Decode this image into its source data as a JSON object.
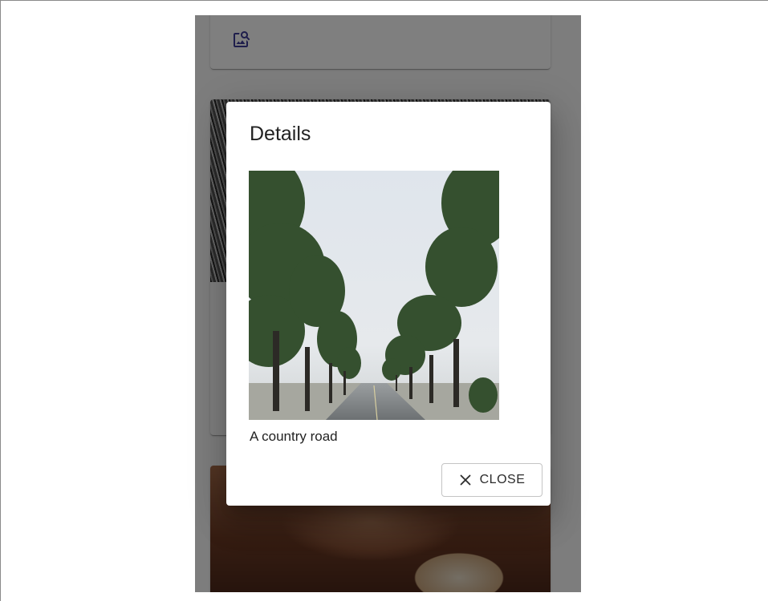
{
  "dialog": {
    "title": "Details",
    "image_alt": "A country road",
    "caption": "A country road",
    "close_label": "CLOSE"
  },
  "background": {
    "icons": {
      "image_search": "image-search-icon"
    }
  },
  "colors": {
    "accent": "#3f3d99",
    "scrim": "rgba(0,0,0,0.5)"
  }
}
